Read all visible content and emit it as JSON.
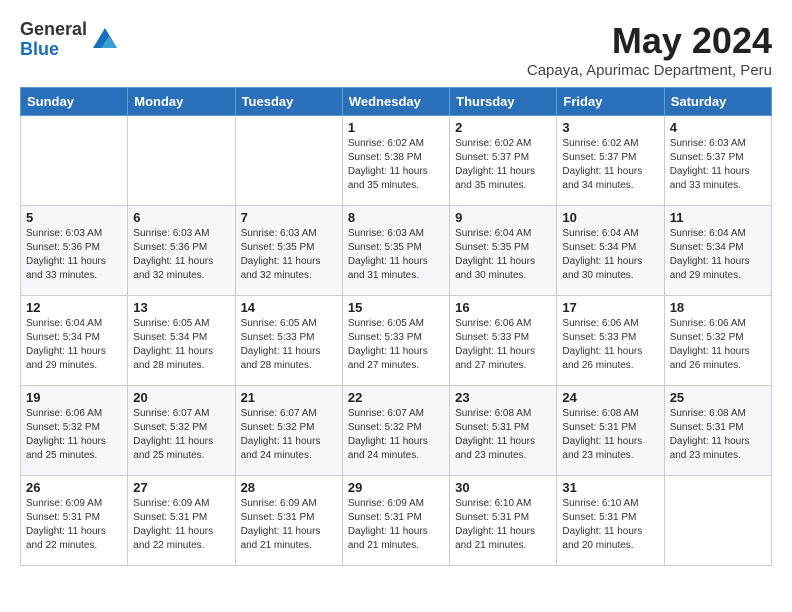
{
  "header": {
    "logo_general": "General",
    "logo_blue": "Blue",
    "title": "May 2024",
    "subtitle": "Capaya, Apurimac Department, Peru"
  },
  "weekdays": [
    "Sunday",
    "Monday",
    "Tuesday",
    "Wednesday",
    "Thursday",
    "Friday",
    "Saturday"
  ],
  "weeks": [
    [
      {
        "day": "",
        "sunrise": "",
        "sunset": "",
        "daylight": ""
      },
      {
        "day": "",
        "sunrise": "",
        "sunset": "",
        "daylight": ""
      },
      {
        "day": "",
        "sunrise": "",
        "sunset": "",
        "daylight": ""
      },
      {
        "day": "1",
        "sunrise": "Sunrise: 6:02 AM",
        "sunset": "Sunset: 5:38 PM",
        "daylight": "Daylight: 11 hours and 35 minutes."
      },
      {
        "day": "2",
        "sunrise": "Sunrise: 6:02 AM",
        "sunset": "Sunset: 5:37 PM",
        "daylight": "Daylight: 11 hours and 35 minutes."
      },
      {
        "day": "3",
        "sunrise": "Sunrise: 6:02 AM",
        "sunset": "Sunset: 5:37 PM",
        "daylight": "Daylight: 11 hours and 34 minutes."
      },
      {
        "day": "4",
        "sunrise": "Sunrise: 6:03 AM",
        "sunset": "Sunset: 5:37 PM",
        "daylight": "Daylight: 11 hours and 33 minutes."
      }
    ],
    [
      {
        "day": "5",
        "sunrise": "Sunrise: 6:03 AM",
        "sunset": "Sunset: 5:36 PM",
        "daylight": "Daylight: 11 hours and 33 minutes."
      },
      {
        "day": "6",
        "sunrise": "Sunrise: 6:03 AM",
        "sunset": "Sunset: 5:36 PM",
        "daylight": "Daylight: 11 hours and 32 minutes."
      },
      {
        "day": "7",
        "sunrise": "Sunrise: 6:03 AM",
        "sunset": "Sunset: 5:35 PM",
        "daylight": "Daylight: 11 hours and 32 minutes."
      },
      {
        "day": "8",
        "sunrise": "Sunrise: 6:03 AM",
        "sunset": "Sunset: 5:35 PM",
        "daylight": "Daylight: 11 hours and 31 minutes."
      },
      {
        "day": "9",
        "sunrise": "Sunrise: 6:04 AM",
        "sunset": "Sunset: 5:35 PM",
        "daylight": "Daylight: 11 hours and 30 minutes."
      },
      {
        "day": "10",
        "sunrise": "Sunrise: 6:04 AM",
        "sunset": "Sunset: 5:34 PM",
        "daylight": "Daylight: 11 hours and 30 minutes."
      },
      {
        "day": "11",
        "sunrise": "Sunrise: 6:04 AM",
        "sunset": "Sunset: 5:34 PM",
        "daylight": "Daylight: 11 hours and 29 minutes."
      }
    ],
    [
      {
        "day": "12",
        "sunrise": "Sunrise: 6:04 AM",
        "sunset": "Sunset: 5:34 PM",
        "daylight": "Daylight: 11 hours and 29 minutes."
      },
      {
        "day": "13",
        "sunrise": "Sunrise: 6:05 AM",
        "sunset": "Sunset: 5:34 PM",
        "daylight": "Daylight: 11 hours and 28 minutes."
      },
      {
        "day": "14",
        "sunrise": "Sunrise: 6:05 AM",
        "sunset": "Sunset: 5:33 PM",
        "daylight": "Daylight: 11 hours and 28 minutes."
      },
      {
        "day": "15",
        "sunrise": "Sunrise: 6:05 AM",
        "sunset": "Sunset: 5:33 PM",
        "daylight": "Daylight: 11 hours and 27 minutes."
      },
      {
        "day": "16",
        "sunrise": "Sunrise: 6:06 AM",
        "sunset": "Sunset: 5:33 PM",
        "daylight": "Daylight: 11 hours and 27 minutes."
      },
      {
        "day": "17",
        "sunrise": "Sunrise: 6:06 AM",
        "sunset": "Sunset: 5:33 PM",
        "daylight": "Daylight: 11 hours and 26 minutes."
      },
      {
        "day": "18",
        "sunrise": "Sunrise: 6:06 AM",
        "sunset": "Sunset: 5:32 PM",
        "daylight": "Daylight: 11 hours and 26 minutes."
      }
    ],
    [
      {
        "day": "19",
        "sunrise": "Sunrise: 6:06 AM",
        "sunset": "Sunset: 5:32 PM",
        "daylight": "Daylight: 11 hours and 25 minutes."
      },
      {
        "day": "20",
        "sunrise": "Sunrise: 6:07 AM",
        "sunset": "Sunset: 5:32 PM",
        "daylight": "Daylight: 11 hours and 25 minutes."
      },
      {
        "day": "21",
        "sunrise": "Sunrise: 6:07 AM",
        "sunset": "Sunset: 5:32 PM",
        "daylight": "Daylight: 11 hours and 24 minutes."
      },
      {
        "day": "22",
        "sunrise": "Sunrise: 6:07 AM",
        "sunset": "Sunset: 5:32 PM",
        "daylight": "Daylight: 11 hours and 24 minutes."
      },
      {
        "day": "23",
        "sunrise": "Sunrise: 6:08 AM",
        "sunset": "Sunset: 5:31 PM",
        "daylight": "Daylight: 11 hours and 23 minutes."
      },
      {
        "day": "24",
        "sunrise": "Sunrise: 6:08 AM",
        "sunset": "Sunset: 5:31 PM",
        "daylight": "Daylight: 11 hours and 23 minutes."
      },
      {
        "day": "25",
        "sunrise": "Sunrise: 6:08 AM",
        "sunset": "Sunset: 5:31 PM",
        "daylight": "Daylight: 11 hours and 23 minutes."
      }
    ],
    [
      {
        "day": "26",
        "sunrise": "Sunrise: 6:09 AM",
        "sunset": "Sunset: 5:31 PM",
        "daylight": "Daylight: 11 hours and 22 minutes."
      },
      {
        "day": "27",
        "sunrise": "Sunrise: 6:09 AM",
        "sunset": "Sunset: 5:31 PM",
        "daylight": "Daylight: 11 hours and 22 minutes."
      },
      {
        "day": "28",
        "sunrise": "Sunrise: 6:09 AM",
        "sunset": "Sunset: 5:31 PM",
        "daylight": "Daylight: 11 hours and 21 minutes."
      },
      {
        "day": "29",
        "sunrise": "Sunrise: 6:09 AM",
        "sunset": "Sunset: 5:31 PM",
        "daylight": "Daylight: 11 hours and 21 minutes."
      },
      {
        "day": "30",
        "sunrise": "Sunrise: 6:10 AM",
        "sunset": "Sunset: 5:31 PM",
        "daylight": "Daylight: 11 hours and 21 minutes."
      },
      {
        "day": "31",
        "sunrise": "Sunrise: 6:10 AM",
        "sunset": "Sunset: 5:31 PM",
        "daylight": "Daylight: 11 hours and 20 minutes."
      },
      {
        "day": "",
        "sunrise": "",
        "sunset": "",
        "daylight": ""
      }
    ]
  ]
}
